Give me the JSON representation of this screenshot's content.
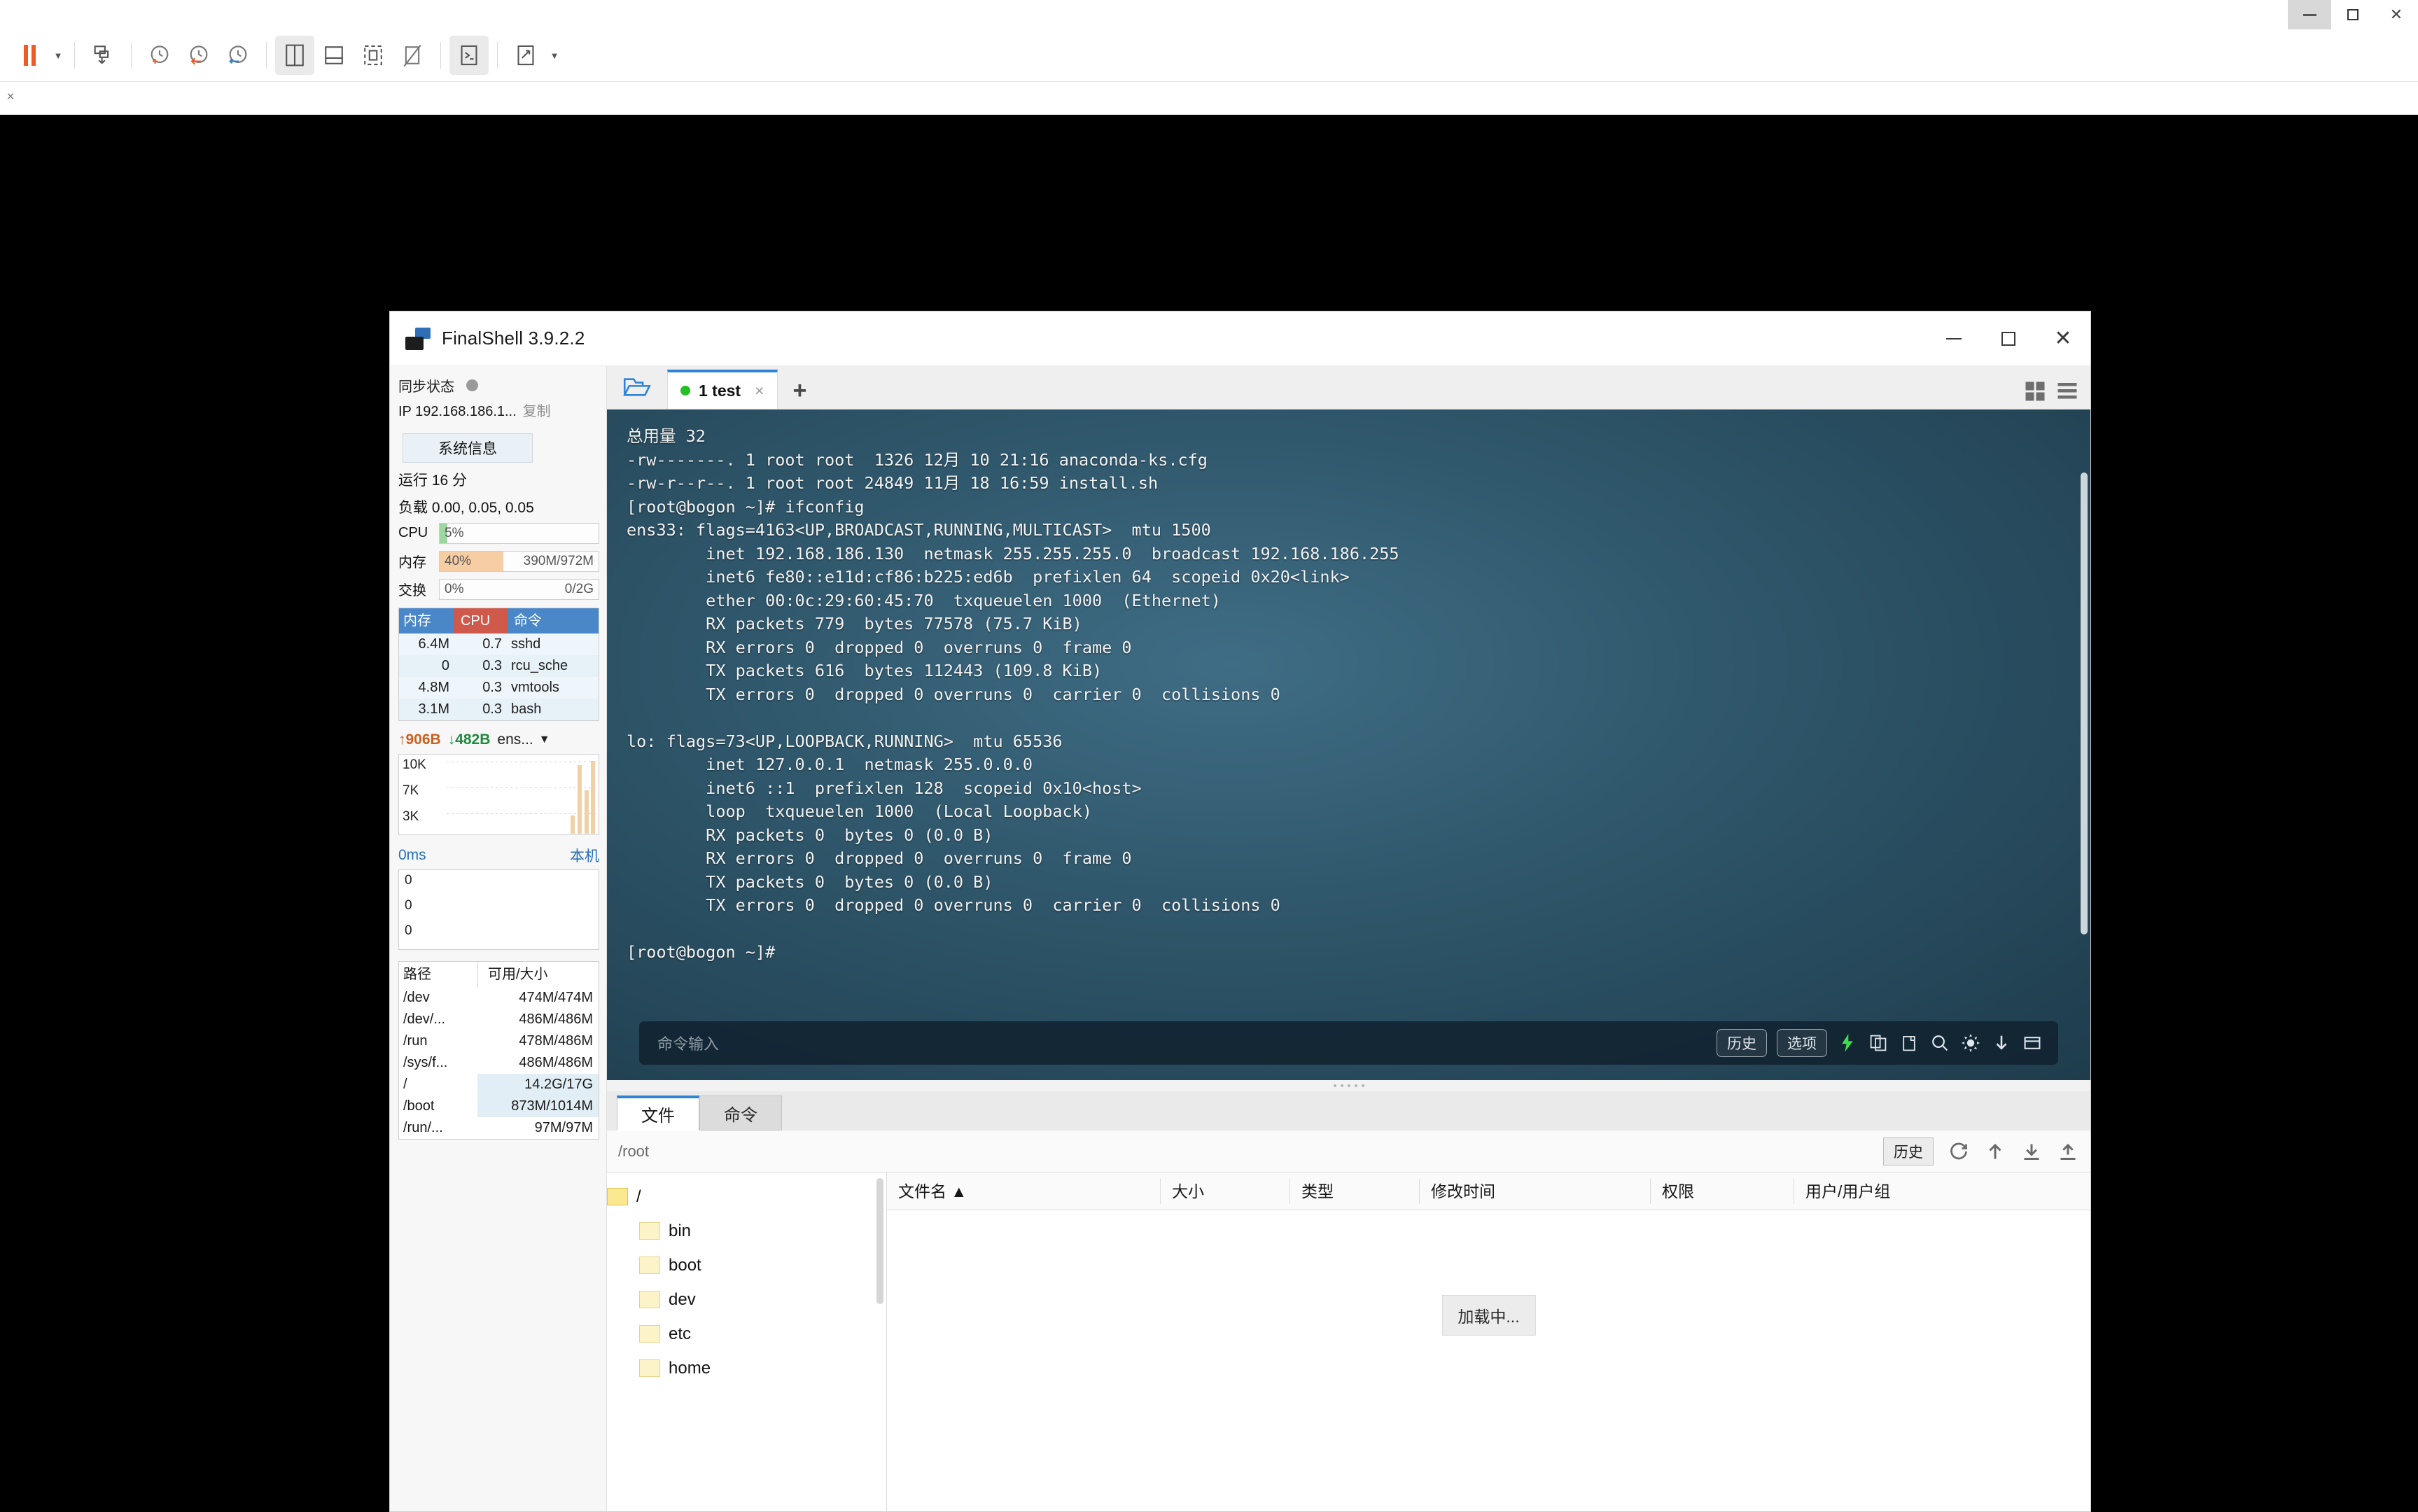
{
  "host": {
    "window_controls": [
      "minimize",
      "maximize",
      "close"
    ],
    "toolbar": [
      {
        "name": "pause-button",
        "label": "pause"
      },
      {
        "name": "pause-dropdown",
        "label": "▾"
      },
      {
        "name": "screenshot-button",
        "label": "screenshot"
      },
      {
        "name": "history-clock-add",
        "label": "add-snapshot"
      },
      {
        "name": "history-clock-back",
        "label": "revert-snapshot"
      },
      {
        "name": "history-clock-manage",
        "label": "manage-snapshots"
      },
      {
        "name": "layout-split-button",
        "label": "split-view"
      },
      {
        "name": "layout-stack-button",
        "label": "stacked-view"
      },
      {
        "name": "fit-screen-button",
        "label": "fit-screen"
      },
      {
        "name": "no-screen-button",
        "label": "disconnect-screen"
      },
      {
        "name": "console-button",
        "label": "console"
      },
      {
        "name": "fullscreen-button",
        "label": "fullscreen"
      },
      {
        "name": "fullscreen-dropdown",
        "label": "▾"
      }
    ]
  },
  "app": {
    "title": "FinalShell 3.9.2.2"
  },
  "sidebar": {
    "sync_label": "同步状态",
    "ip_label": "IP 192.168.186.1...",
    "copy_label": "复制",
    "sysinfo_button": "系统信息",
    "uptime": "运行 16 分",
    "load": "负载 0.00, 0.05, 0.05",
    "meters": [
      {
        "name": "CPU",
        "percent": "5%",
        "right": "",
        "fill_pct": 5,
        "fill_color": "#9ed6a1"
      },
      {
        "name": "内存",
        "percent": "40%",
        "right": "390M/972M",
        "fill_pct": 40,
        "fill_color": "#f7cda4"
      },
      {
        "name": "交换",
        "percent": "0%",
        "right": "0/2G",
        "fill_pct": 0,
        "fill_color": "#f7cda4"
      }
    ],
    "proc_headers": [
      "内存",
      "CPU",
      "命令"
    ],
    "processes": [
      {
        "mem": "6.4M",
        "cpu": "0.7",
        "cmd": "sshd"
      },
      {
        "mem": "0",
        "cpu": "0.3",
        "cmd": "rcu_sche"
      },
      {
        "mem": "4.8M",
        "cpu": "0.3",
        "cmd": "vmtools"
      },
      {
        "mem": "3.1M",
        "cpu": "0.3",
        "cmd": "bash"
      }
    ],
    "net": {
      "up": "906B",
      "down": "482B",
      "iface": "ens...",
      "y_labels": [
        "10K",
        "7K",
        "3K"
      ]
    },
    "latency": {
      "value": "0ms",
      "host": "本机",
      "y_labels": [
        "0",
        "0",
        "0"
      ]
    },
    "disk_headers": [
      "路径",
      "可用/大小"
    ],
    "disks": [
      {
        "path": "/dev",
        "value": "474M/474M",
        "hl": false
      },
      {
        "path": "/dev/...",
        "value": "486M/486M",
        "hl": false
      },
      {
        "path": "/run",
        "value": "478M/486M",
        "hl": false
      },
      {
        "path": "/sys/f...",
        "value": "486M/486M",
        "hl": false
      },
      {
        "path": "/",
        "value": "14.2G/17G",
        "hl": true
      },
      {
        "path": "/boot",
        "value": "873M/1014M",
        "hl": true
      },
      {
        "path": "/run/...",
        "value": "97M/97M",
        "hl": false
      }
    ]
  },
  "terminal": {
    "tab": {
      "label": "1 test",
      "close": "×",
      "status": "connected"
    },
    "new_tab": "+",
    "output": "总用量 32\n-rw-------. 1 root root  1326 12月 10 21:16 anaconda-ks.cfg\n-rw-r--r--. 1 root root 24849 11月 18 16:59 install.sh\n[root@bogon ~]# ifconfig\nens33: flags=4163<UP,BROADCAST,RUNNING,MULTICAST>  mtu 1500\n        inet 192.168.186.130  netmask 255.255.255.0  broadcast 192.168.186.255\n        inet6 fe80::e11d:cf86:b225:ed6b  prefixlen 64  scopeid 0x20<link>\n        ether 00:0c:29:60:45:70  txqueuelen 1000  (Ethernet)\n        RX packets 779  bytes 77578 (75.7 KiB)\n        RX errors 0  dropped 0  overruns 0  frame 0\n        TX packets 616  bytes 112443 (109.8 KiB)\n        TX errors 0  dropped 0 overruns 0  carrier 0  collisions 0\n\nlo: flags=73<UP,LOOPBACK,RUNNING>  mtu 65536\n        inet 127.0.0.1  netmask 255.0.0.0\n        inet6 ::1  prefixlen 128  scopeid 0x10<host>\n        loop  txqueuelen 1000  (Local Loopback)\n        RX packets 0  bytes 0 (0.0 B)\n        RX errors 0  dropped 0  overruns 0  frame 0\n        TX packets 0  bytes 0 (0.0 B)\n        TX errors 0  dropped 0 overruns 0  carrier 0  collisions 0\n\n[root@bogon ~]# ",
    "command_placeholder": "命令输入",
    "history_button": "历史",
    "options_button": "选项"
  },
  "filepanel": {
    "tabs": [
      {
        "label": "文件",
        "active": true
      },
      {
        "label": "命令",
        "active": false
      }
    ],
    "path": "/root",
    "history_button": "历史",
    "columns": [
      "文件名 ▲",
      "大小",
      "类型",
      "修改时间",
      "权限",
      "用户/用户组"
    ],
    "loading": "加载中...",
    "tree": [
      {
        "label": "/",
        "depth": 0,
        "root": true
      },
      {
        "label": "bin",
        "depth": 1,
        "root": false
      },
      {
        "label": "boot",
        "depth": 1,
        "root": false
      },
      {
        "label": "dev",
        "depth": 1,
        "root": false
      },
      {
        "label": "etc",
        "depth": 1,
        "root": false
      },
      {
        "label": "home",
        "depth": 1,
        "root": false
      }
    ]
  },
  "colors": {
    "accent": "#2f83d8",
    "orange": "#f05a28",
    "green": "#22c022",
    "proc_header_blue": "#4a87c8",
    "proc_header_red": "#cf5a4b"
  }
}
